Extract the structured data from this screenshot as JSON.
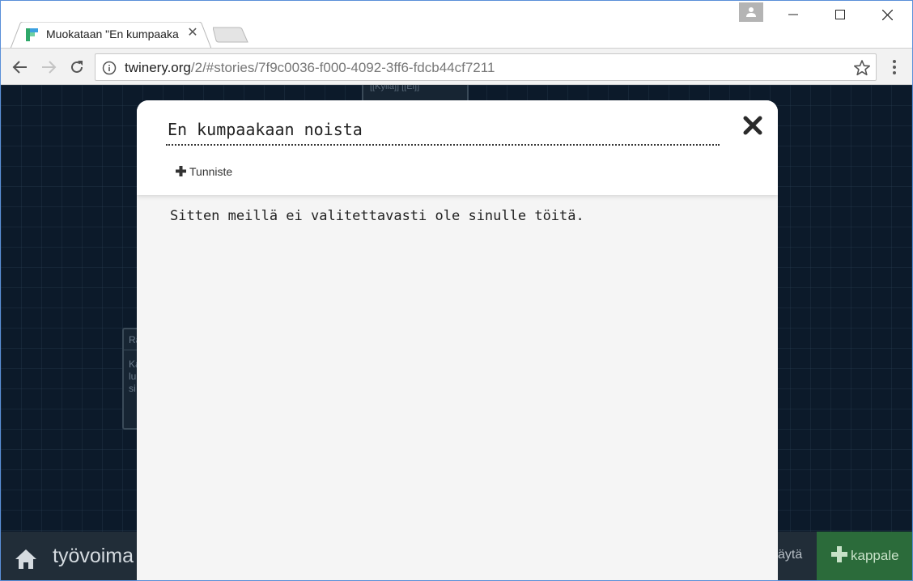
{
  "browser": {
    "tab": {
      "title": "Muokataan \"En kumpaakaan noista\"",
      "close_symbol": "✕"
    },
    "address": {
      "host": "twinery.org",
      "path": "/2/#stories/7f9c0036-f000-4092-3ff6-fdcb44cf7211"
    }
  },
  "story_map": {
    "passage_top_text": "[[Kyllä]] [[Ei]]",
    "passage_left": {
      "title": "Ra",
      "body": "Ka\nlu\nsi"
    }
  },
  "bottom_bar": {
    "story_name": "työvoima",
    "show_label": "äytä",
    "add_passage_label": "kappale"
  },
  "dialog": {
    "title": "En kumpaakaan noista",
    "tag_button_label": "Tunniste",
    "passage_text": "Sitten meillä ei valitettavasti ole sinulle töitä."
  },
  "colors": {
    "page_background": "#0c1a2a",
    "add_passage_green": "#2b6b3a",
    "dialog_background": "#f5f5f5"
  },
  "icons": {
    "favicon": "twine-logo-icon",
    "profile": "person-icon",
    "back": "back-arrow-icon",
    "forward": "forward-arrow-icon",
    "reload": "reload-icon",
    "info": "info-icon",
    "bookmark": "star-icon",
    "menu": "more-vert-icon",
    "home": "home-icon",
    "close": "close-x-icon",
    "plus": "plus-icon"
  }
}
